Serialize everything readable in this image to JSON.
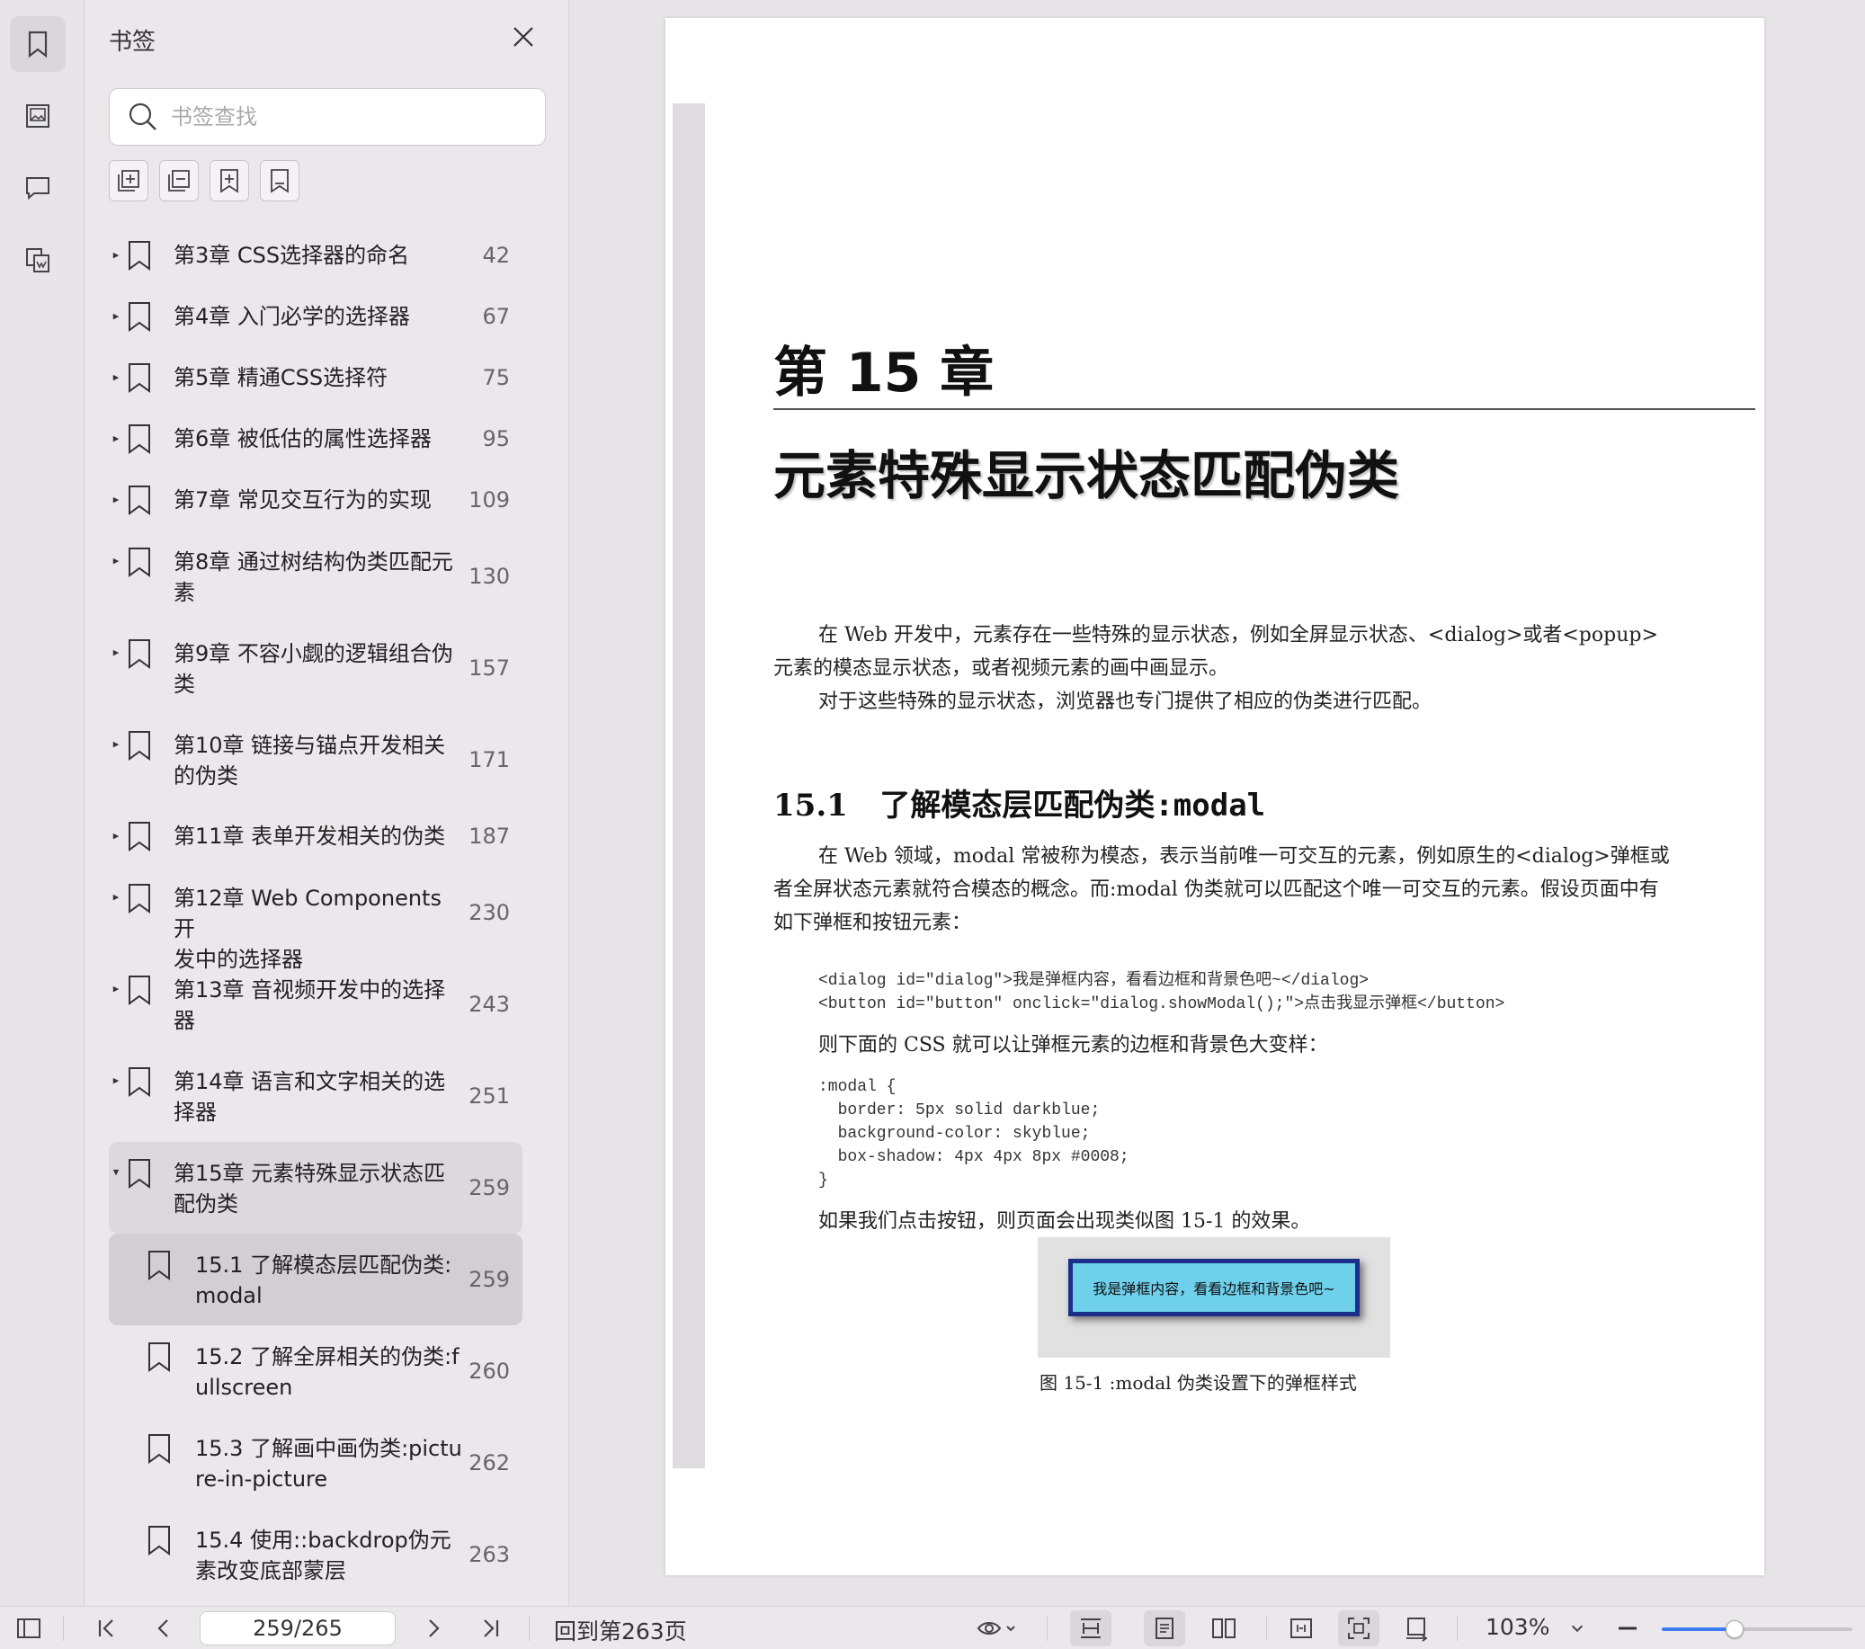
{
  "rail": {
    "items": [
      {
        "icon": "bookmark-icon",
        "active": true
      },
      {
        "icon": "thumbnail-icon",
        "active": false
      },
      {
        "icon": "comment-icon",
        "active": false
      },
      {
        "icon": "extract-icon",
        "active": false
      }
    ]
  },
  "panel": {
    "title": "书签",
    "search_placeholder": "书签查找",
    "tools": [
      "expand-all-icon",
      "collapse-all-icon",
      "add-bookmark-icon",
      "bookmark-outline-icon"
    ],
    "items": [
      {
        "label": "第3章 CSS选择器的命名",
        "page": "42",
        "arrow": "▸",
        "lines": 1
      },
      {
        "label": "第4章 入门必学的选择器",
        "page": "67",
        "arrow": "▸",
        "lines": 1
      },
      {
        "label": "第5章 精通CSS选择符",
        "page": "75",
        "arrow": "▸",
        "lines": 1
      },
      {
        "label": "第6章 被低估的属性选择器",
        "page": "95",
        "arrow": "▸",
        "lines": 1
      },
      {
        "label": "第7章 常见交互行为的实现",
        "page": "109",
        "arrow": "▸",
        "lines": 1
      },
      {
        "label": "第8章 通过树结构伪类匹配元\n素",
        "page": "130",
        "arrow": "▸",
        "lines": 2
      },
      {
        "label": "第9章 不容小觑的逻辑组合伪\n类",
        "page": "157",
        "arrow": "▸",
        "lines": 2
      },
      {
        "label": "第10章 链接与锚点开发相关\n的伪类",
        "page": "171",
        "arrow": "▸",
        "lines": 2
      },
      {
        "label": "第11章 表单开发相关的伪类",
        "page": "187",
        "arrow": "▸",
        "lines": 1
      },
      {
        "label": "第12章 Web Components开\n发中的选择器",
        "page": "230",
        "arrow": "▸",
        "lines": 2
      },
      {
        "label": "第13章 音视频开发中的选择\n器",
        "page": "243",
        "arrow": "▸",
        "lines": 2
      },
      {
        "label": "第14章 语言和文字相关的选\n择器",
        "page": "251",
        "arrow": "▸",
        "lines": 2
      },
      {
        "label": "第15章 元素特殊显示状态匹\n配伪类",
        "page": "259",
        "arrow": "▾",
        "lines": 2,
        "state": "selected"
      },
      {
        "label": "15.1 了解模态层匹配伪类:\nmodal",
        "page": "259",
        "arrow": "",
        "lines": 2,
        "sub": true,
        "state": "current"
      },
      {
        "label": "15.2 了解全屏相关的伪类:f\nullscreen",
        "page": "260",
        "arrow": "",
        "lines": 2,
        "sub": true
      },
      {
        "label": "15.3 了解画中画伪类:pictu\nre-in-picture",
        "page": "262",
        "arrow": "",
        "lines": 2,
        "sub": true
      },
      {
        "label": "15.4 使用::backdrop伪元\n素改变底部蒙层",
        "page": "263",
        "arrow": "",
        "lines": 2,
        "sub": true
      }
    ]
  },
  "doc": {
    "chapter_num": "第 15 章",
    "chapter_title": "元素特殊显示状态匹配伪类",
    "intro_1": "在 Web 开发中，元素存在一些特殊的显示状态，例如全屏显示状态、<dialog>或者<popup>元素的模态显示状态，或者视频元素的画中画显示。",
    "intro_2": "对于这些特殊的显示状态，浏览器也专门提供了相应的伪类进行匹配。",
    "section_num": "15.1",
    "section_title": "了解模态层匹配伪类",
    "section_code": ":modal",
    "para_1": "在 Web 领域，modal 常被称为模态，表示当前唯一可交互的元素，例如原生的<dialog>弹框或者全屏状态元素就符合模态的概念。而:modal 伪类就可以匹配这个唯一可交互的元素。假设页面中有如下弹框和按钮元素：",
    "code_1": "<dialog id=\"dialog\">我是弹框内容，看看边框和背景色吧~</dialog>\n<button id=\"button\" onclick=\"dialog.showModal();\">点击我显示弹框</button>",
    "para_2": "则下面的 CSS 就可以让弹框元素的边框和背景色大变样：",
    "code_2": ":modal {\n  border: 5px solid darkblue;\n  background-color: skyblue;\n  box-shadow: 4px 4px 8px #0008;\n}",
    "para_3": "如果我们点击按钮，则页面会出现类似图 15-1 的效果。",
    "figure_text": "我是弹框内容，看看边框和背景色吧~",
    "figure_caption": "图 15-1   :modal 伪类设置下的弹框样式"
  },
  "bottombar": {
    "page_value": "259/265",
    "goto_label": "回到第263页",
    "zoom": "103%",
    "zoom_fraction": 0.38
  }
}
